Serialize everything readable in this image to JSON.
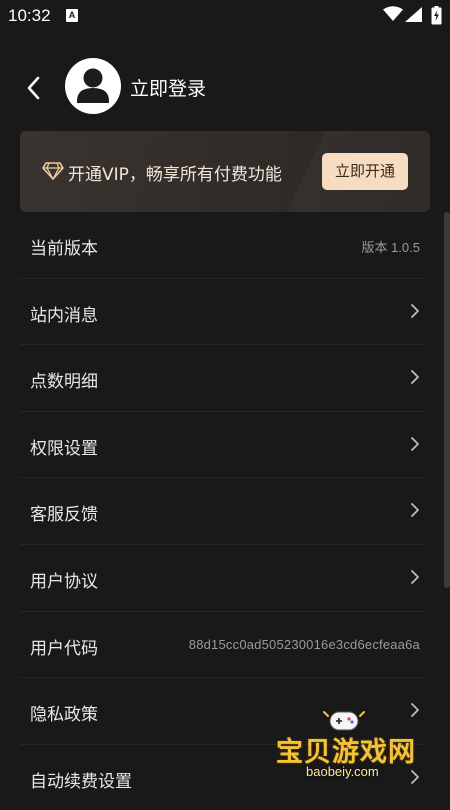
{
  "status_bar": {
    "time": "10:32",
    "notification_glyph": "A",
    "icons": [
      "wifi-icon",
      "signal-icon",
      "battery-icon"
    ]
  },
  "header": {
    "login_label": "立即登录",
    "icons": [
      "chevron-left-icon",
      "avatar-user-icon"
    ]
  },
  "vip": {
    "text": "开通VIP，畅享所有付费功能",
    "button_label": "立即开通",
    "icon": "diamond-icon",
    "colors": {
      "button_bg": "#f6dcc0",
      "banner_bg": "#3a3430"
    }
  },
  "menu": {
    "items": [
      {
        "label": "当前版本",
        "value": "版本 1.0.5"
      },
      {
        "label": "站内消息"
      },
      {
        "label": "点数明细"
      },
      {
        "label": "权限设置"
      },
      {
        "label": "客服反馈"
      },
      {
        "label": "用户协议"
      },
      {
        "label": "用户代码",
        "value": "88d15cc0ad505230016e3cd6ecfeaa6a"
      },
      {
        "label": "隐私政策"
      },
      {
        "label": "自动续费设置"
      }
    ]
  },
  "watermark": {
    "title": "宝贝游戏网",
    "url": "baobeiy.com"
  },
  "colors": {
    "background": "#191919",
    "divider": "#262626",
    "text_primary": "#e8e8e8",
    "text_secondary": "#9a9a9a"
  }
}
